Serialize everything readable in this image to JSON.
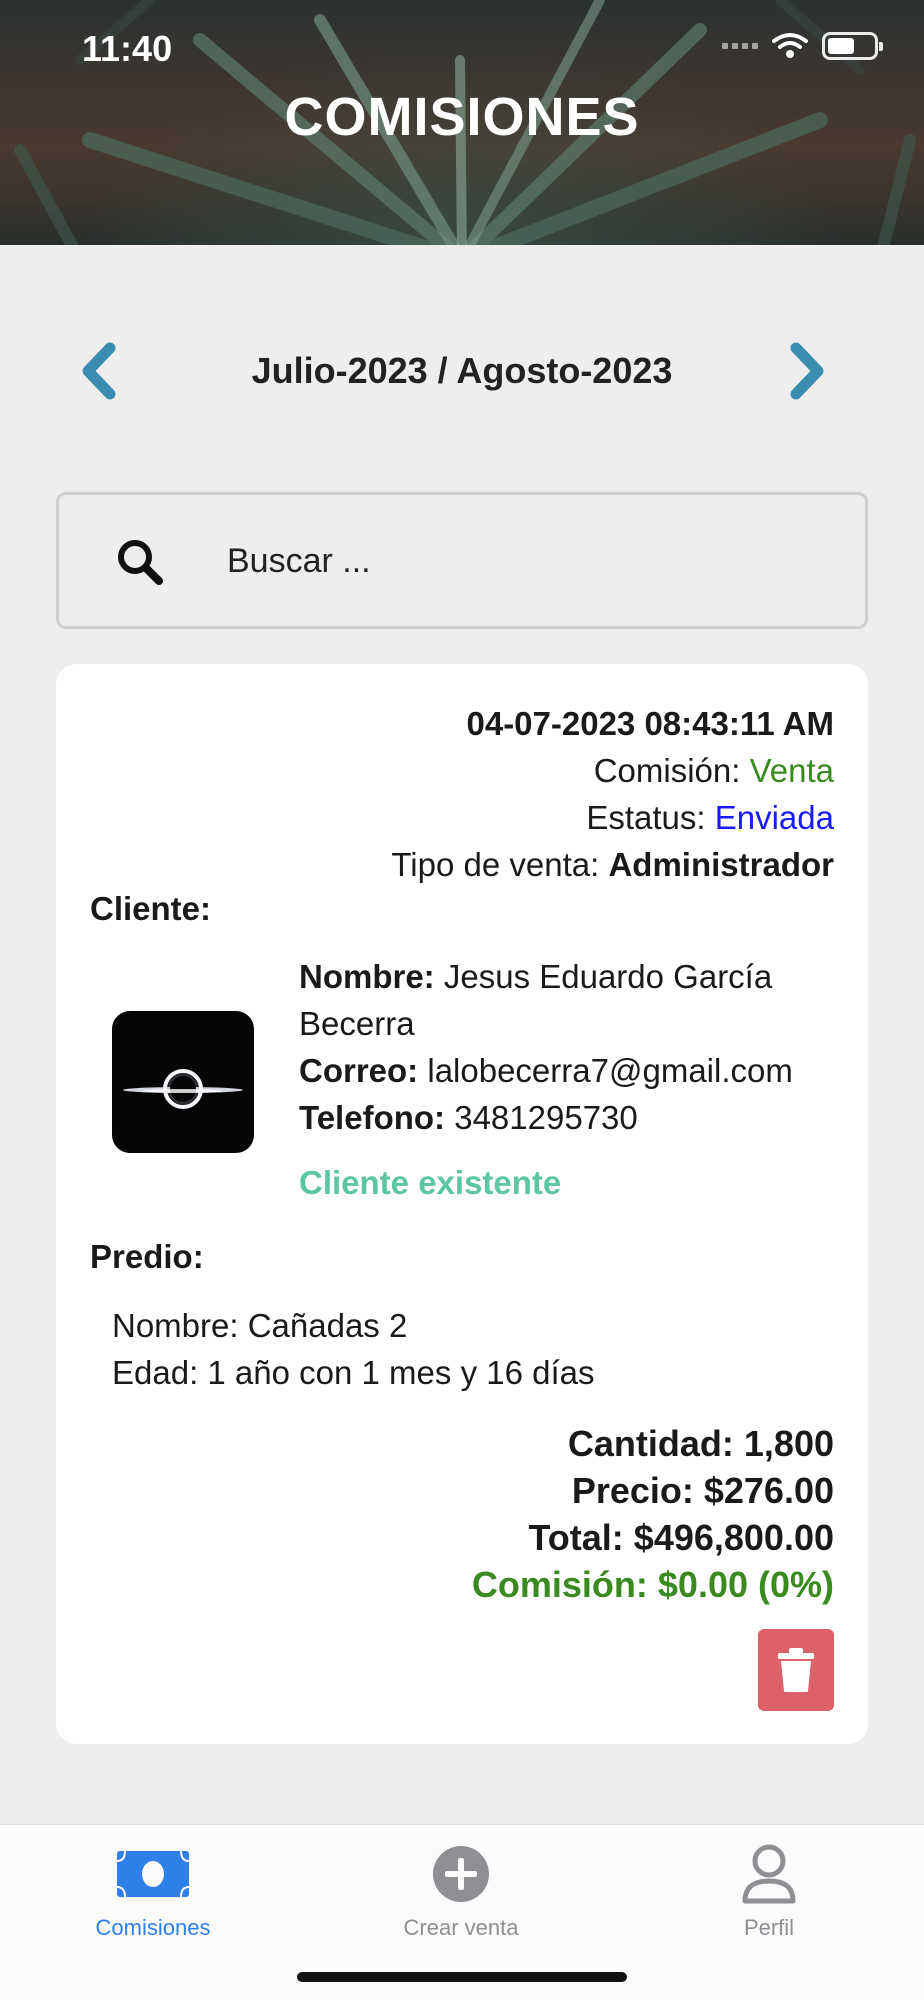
{
  "status_bar": {
    "time": "11:40"
  },
  "header": {
    "title": "COMISIONES"
  },
  "period": {
    "label": "Julio-2023 / Agosto-2023"
  },
  "search": {
    "placeholder": "Buscar ..."
  },
  "sale": {
    "datetime": "04-07-2023 08:43:11 AM",
    "comision_label": "Comisión:",
    "comision_value": "Venta",
    "estatus_label": "Estatus:",
    "estatus_value": "Enviada",
    "tipo_label": "Tipo de venta:",
    "tipo_value": "Administrador",
    "cliente_heading": "Cliente:",
    "cliente": {
      "nombre_label": "Nombre:",
      "nombre_value": "Jesus Eduardo García Becerra",
      "correo_label": "Correo:",
      "correo_value": "lalobecerra7@gmail.com",
      "telefono_label": "Telefono:",
      "telefono_value": "3481295730",
      "status": "Cliente existente"
    },
    "predio_heading": "Predio:",
    "predio": {
      "nombre": "Nombre: Cañadas 2",
      "edad": "Edad: 1 año con 1 mes y 16 días"
    },
    "totals": {
      "cantidad": "Cantidad: 1,800",
      "precio": "Precio: $276.00",
      "total": "Total: $496,800.00",
      "comision": "Comisión: $0.00 (0%)"
    }
  },
  "tabs": [
    {
      "label": "Comisiones",
      "icon": "money-icon",
      "active": true
    },
    {
      "label": "Crear venta",
      "icon": "plus-circle-icon",
      "active": false
    },
    {
      "label": "Perfil",
      "icon": "person-icon",
      "active": false
    }
  ],
  "colors": {
    "accent": "#2f7fe8",
    "chevron": "#3b8db0",
    "green": "#3a8a1f",
    "status_blue": "#1a1aff",
    "client_status": "#5cc6a0",
    "delete": "#dc6169"
  }
}
